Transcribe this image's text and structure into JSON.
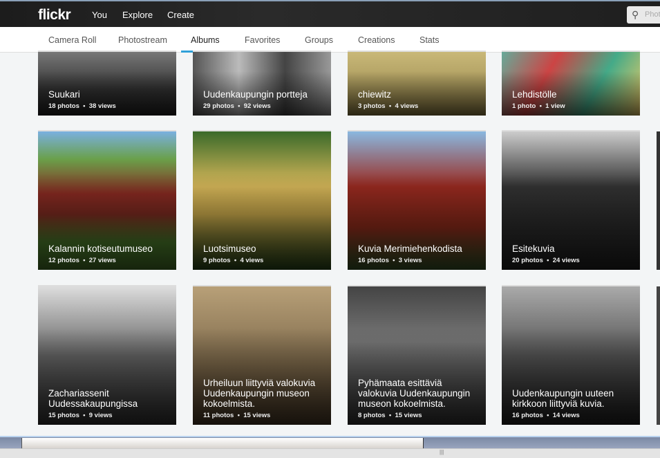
{
  "header": {
    "logo": "flickr",
    "nav": [
      "You",
      "Explore",
      "Create"
    ],
    "search_placeholder": "Phot"
  },
  "tabs": [
    "Camera Roll",
    "Photostream",
    "Albums",
    "Favorites",
    "Groups",
    "Creations",
    "Stats"
  ],
  "active_tab": "Albums",
  "accent": "#2fa0d8",
  "albums": [
    {
      "title": "Suukari",
      "meta": "18 photos  •  38 views"
    },
    {
      "title": "Uudenkaupungin portteja",
      "meta": "29 photos  •  92 views"
    },
    {
      "title": "chiewitz",
      "meta": "3 photos  •  4 views"
    },
    {
      "title": "Lehdistölle",
      "meta": "1 photo  •  1 view"
    },
    {
      "title": "Kalannin kotiseutumuseo",
      "meta": "12 photos  •  27 views"
    },
    {
      "title": "Luotsimuseo",
      "meta": "9 photos  •  4 views"
    },
    {
      "title": "Kuvia Merimiehenkodista",
      "meta": "16 photos  •  3 views"
    },
    {
      "title": "Esitekuvia",
      "meta": "20 photos  •  24 views"
    },
    {
      "title": "Zachariassenit Uudessakaupungissa",
      "meta": "15 photos  •  9 views"
    },
    {
      "title": "Urheiluun liittyviä valokuvia Uudenkaupungin museon kokoelmista.",
      "meta": "11 photos  •  15 views"
    },
    {
      "title": "Pyhämaata esittäviä valokuvia Uudenkaupungin museon kokoelmista.",
      "meta": "8 photos  •  15 views"
    },
    {
      "title": "Uudenkaupungin uuteen kirkkoon liittyviä kuvia.",
      "meta": "16 photos  •  14 views"
    }
  ]
}
